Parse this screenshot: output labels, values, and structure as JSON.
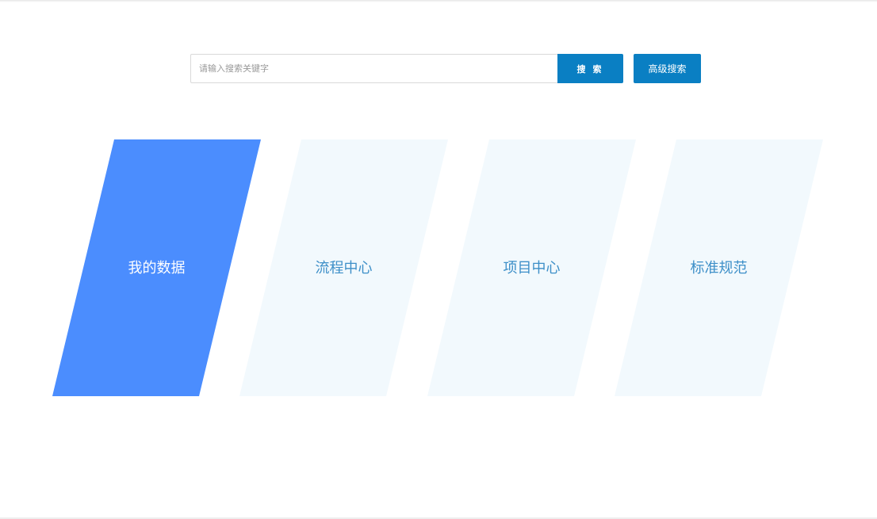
{
  "search": {
    "placeholder": "请输入搜索关键字",
    "value": "",
    "button_label": "搜 索",
    "advanced_label": "高级搜索"
  },
  "cards": [
    {
      "label": "我的数据",
      "active": true
    },
    {
      "label": "流程中心",
      "active": false
    },
    {
      "label": "项目中心",
      "active": false
    },
    {
      "label": "标准规范",
      "active": false
    }
  ],
  "colors": {
    "primary_button": "#0a7fc3",
    "active_card": "#4b8dfe",
    "inactive_card": "#f2f9fd",
    "inactive_card_text": "#3d8fc8"
  }
}
